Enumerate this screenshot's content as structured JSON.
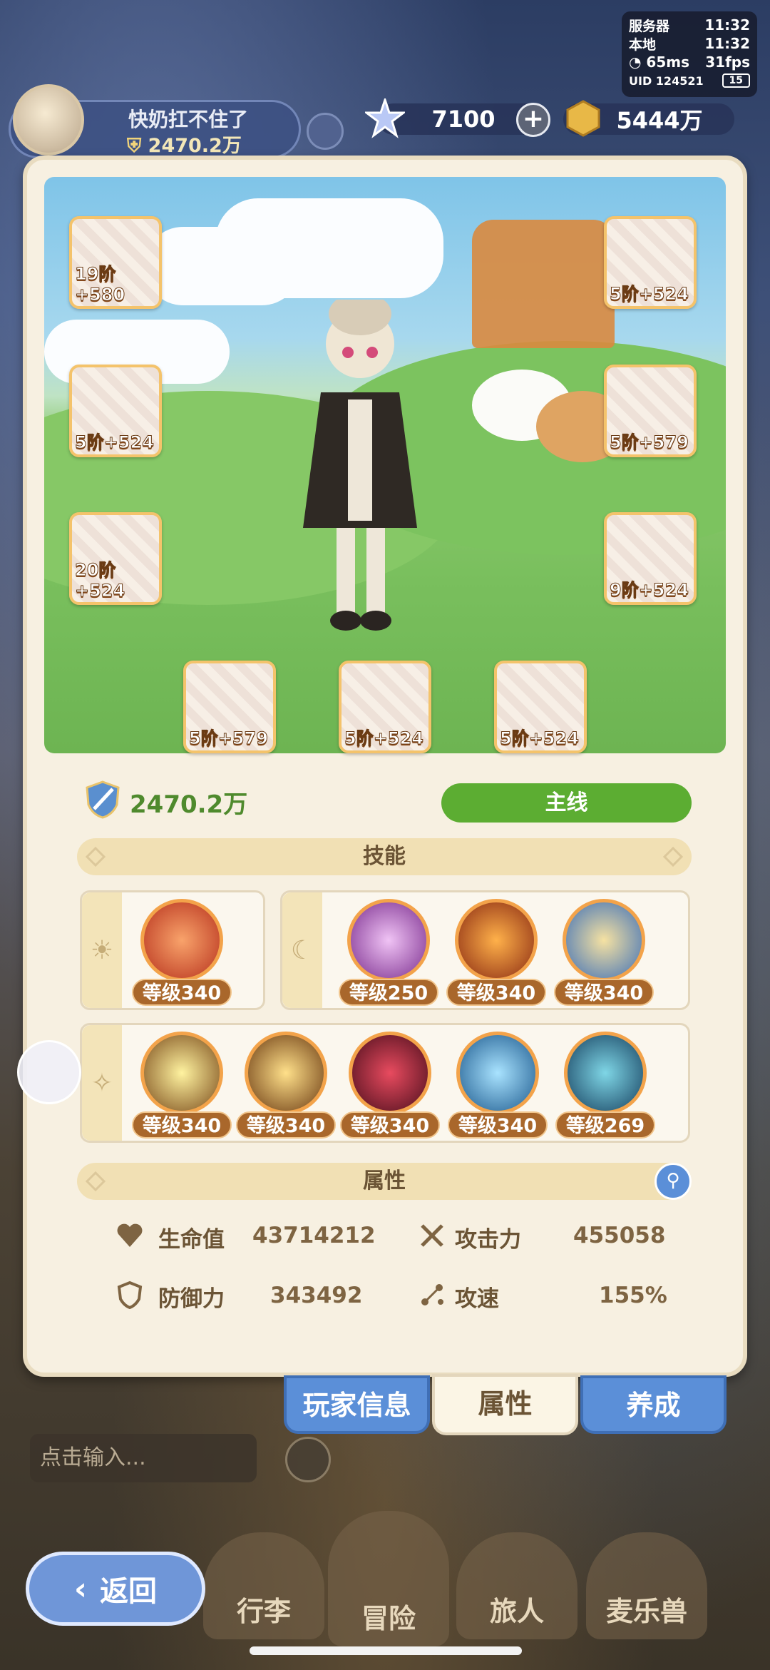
{
  "status": {
    "server_label": "服务器",
    "server_time": "11:32",
    "local_label": "本地",
    "local_time": "11:32",
    "ping": "65ms",
    "fps": "31fps",
    "uid": "UID 124521",
    "battery": "15"
  },
  "player": {
    "name": "快奶扛不住了",
    "power": "2470.2万"
  },
  "currency": {
    "gems": "7100",
    "gold": "5444万"
  },
  "gear": [
    {
      "label": "19阶+580"
    },
    {
      "label": "5阶+524"
    },
    {
      "label": "20阶+524"
    },
    {
      "label": "5阶+524"
    },
    {
      "label": "5阶+579"
    },
    {
      "label": "9阶+524"
    },
    {
      "label": "5阶+579"
    },
    {
      "label": "5阶+524"
    },
    {
      "label": "5阶+524"
    }
  ],
  "power": "2470.2万",
  "mainline_label": "主线",
  "skills_title": "技能",
  "skills_row1_a": [
    {
      "lv": "等级340"
    }
  ],
  "skills_row1_b": [
    {
      "lv": "等级250"
    },
    {
      "lv": "等级340"
    },
    {
      "lv": "等级340"
    }
  ],
  "skills_row2": [
    {
      "lv": "等级340"
    },
    {
      "lv": "等级340"
    },
    {
      "lv": "等级340"
    },
    {
      "lv": "等级340"
    },
    {
      "lv": "等级269"
    }
  ],
  "attributes_title": "属性",
  "attributes": {
    "hp_label": "生命值",
    "hp": "43714212",
    "atk_label": "攻击力",
    "atk": "455058",
    "def_label": "防御力",
    "def": "343492",
    "spd_label": "攻速",
    "spd": "155%"
  },
  "tabs": {
    "player_info": "玩家信息",
    "attributes": "属性",
    "develop": "养成"
  },
  "chat_placeholder": "点击输入...",
  "nav": {
    "luggage": "行李",
    "adventure": "冒险",
    "traveler": "旅人",
    "pet": "麦乐兽"
  },
  "back_label": "返回",
  "colors": {
    "accent_green": "#5cad32",
    "tab_blue": "#5b8fd8",
    "panel": "#f7f0e1"
  }
}
